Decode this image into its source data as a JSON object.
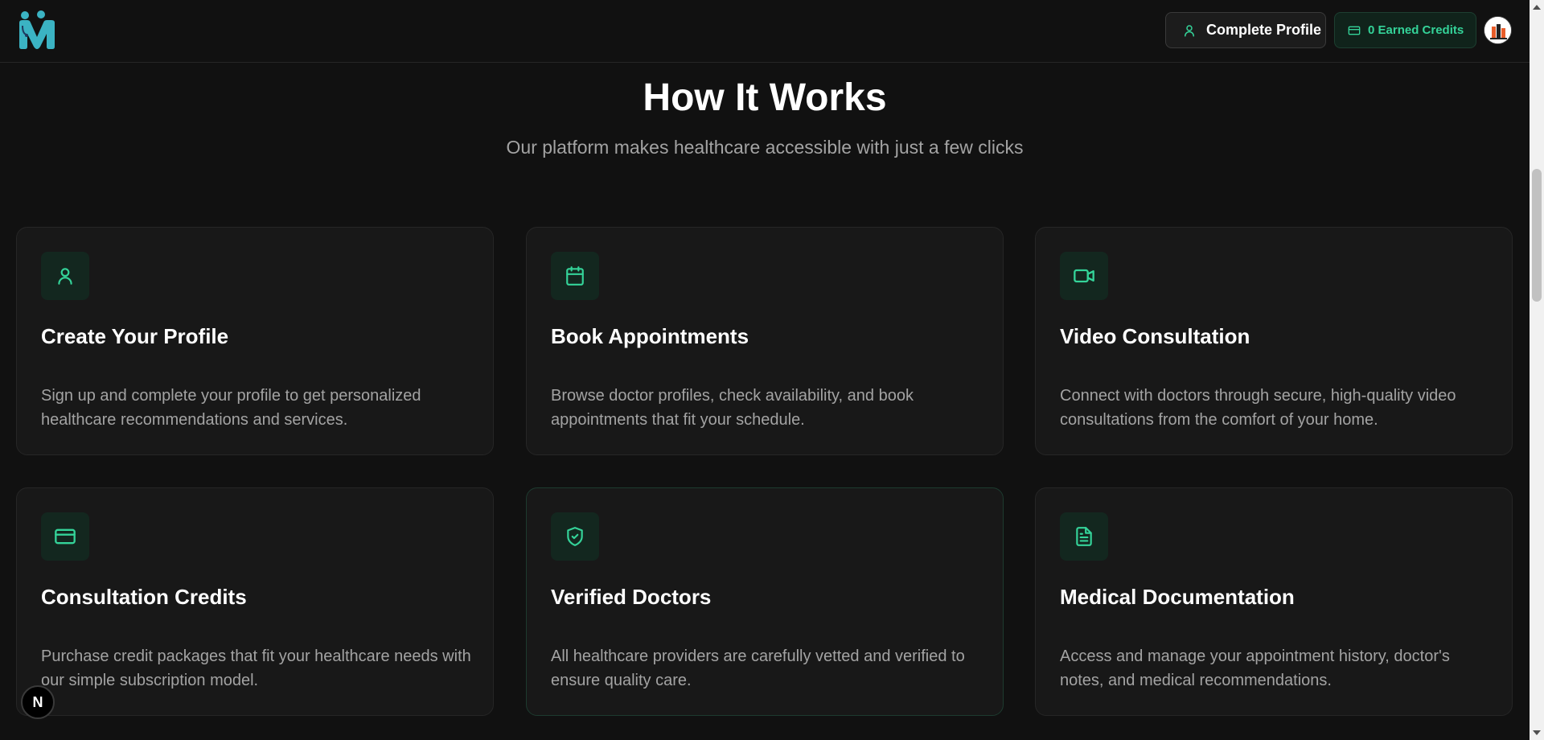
{
  "header": {
    "complete_profile_label": "Complete Profile",
    "credits_label": "0 Earned Credits"
  },
  "section": {
    "title": "How It Works",
    "subtitle": "Our platform makes healthcare accessible with just a few clicks"
  },
  "cards": [
    {
      "icon": "user-icon",
      "title": "Create Your Profile",
      "text": "Sign up and complete your profile to get personalized healthcare recommendations and services."
    },
    {
      "icon": "calendar-icon",
      "title": "Book Appointments",
      "text": "Browse doctor profiles, check availability, and book appointments that fit your schedule."
    },
    {
      "icon": "video-icon",
      "title": "Video Consultation",
      "text": "Connect with doctors through secure, high-quality video consultations from the comfort of your home."
    },
    {
      "icon": "credit-card-icon",
      "title": "Consultation Credits",
      "text": "Purchase credit packages that fit your healthcare needs with our simple subscription model."
    },
    {
      "icon": "shield-check-icon",
      "title": "Verified Doctors",
      "text": "All healthcare providers are carefully vetted and verified to ensure quality care."
    },
    {
      "icon": "file-text-icon",
      "title": "Medical Documentation",
      "text": "Access and manage your appointment history, doctor's notes, and medical recommendations."
    }
  ],
  "badge": {
    "label": "N"
  },
  "colors": {
    "accent": "#34d399",
    "background": "#111111",
    "card": "#181818",
    "logo": "#3bb3c3"
  }
}
